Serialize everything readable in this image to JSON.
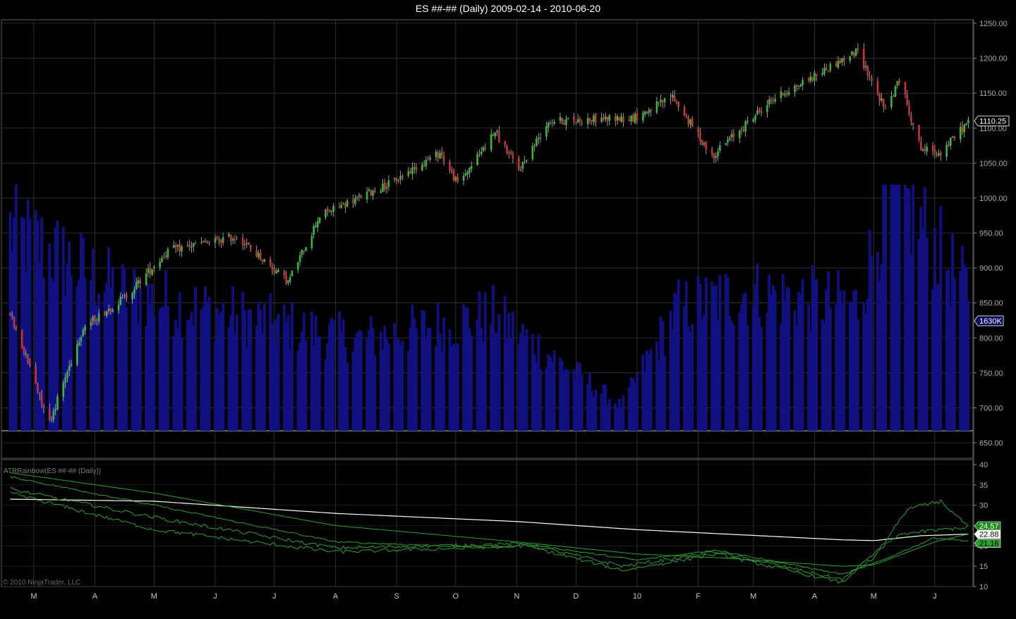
{
  "chart_title": "ES ##-## (Daily)  2009-02-14 - 2010-06-20",
  "price_axis": {
    "ticks": [
      "1250.00",
      "1200.00",
      "1150.00",
      "1100.00",
      "1050.00",
      "1000.00",
      "950.00",
      "900.00",
      "850.00",
      "800.00",
      "750.00",
      "700.00",
      "650.00"
    ]
  },
  "last_price_tag": "1110.25",
  "volume_tag": "1630K",
  "indicator_label": "ATRRainbow(ES ##-## (Daily))",
  "indicator_axis": {
    "ticks": [
      "40",
      "35",
      "30",
      "25",
      "20",
      "15",
      "10"
    ]
  },
  "indicator_tags": [
    "24.57",
    "22.88",
    "21.16"
  ],
  "x_axis": {
    "months": [
      "M",
      "A",
      "M",
      "J",
      "J",
      "A",
      "S",
      "O",
      "N",
      "D",
      "10",
      "F",
      "M",
      "A",
      "M",
      "J"
    ]
  },
  "copyright": "© 2010 NinjaTrader, LLC",
  "colors": {
    "up_candle": "#3cb43c",
    "down_candle": "#c83232",
    "volume": "#101080",
    "atr_line": "#2e9e2e",
    "atr_slow": "#ffffff",
    "grid": "#4a4a4a"
  },
  "chart_data": [
    {
      "type": "candlestick",
      "title": "ES ##-## (Daily)  2009-02-14 - 2010-06-20",
      "x_range": [
        "2009-02-14",
        "2010-06-20"
      ],
      "ylim": [
        650,
        1250
      ],
      "grid": true,
      "last_price": 1110.25,
      "close_waypoints": [
        [
          "2009-02-17",
          835
        ],
        [
          "2009-03-09",
          680
        ],
        [
          "2009-03-26",
          815
        ],
        [
          "2009-04-17",
          860
        ],
        [
          "2009-05-08",
          925
        ],
        [
          "2009-06-12",
          945
        ],
        [
          "2009-07-08",
          880
        ],
        [
          "2009-07-24",
          975
        ],
        [
          "2009-08-28",
          1020
        ],
        [
          "2009-09-23",
          1065
        ],
        [
          "2009-10-02",
          1020
        ],
        [
          "2009-10-21",
          1095
        ],
        [
          "2009-11-02",
          1040
        ],
        [
          "2009-11-17",
          1110
        ],
        [
          "2009-12-31",
          1115
        ],
        [
          "2010-01-19",
          1145
        ],
        [
          "2010-02-08",
          1060
        ],
        [
          "2010-03-10",
          1140
        ],
        [
          "2010-04-23",
          1210
        ],
        [
          "2010-05-07",
          1125
        ],
        [
          "2010-05-14",
          1170
        ],
        [
          "2010-05-25",
          1070
        ],
        [
          "2010-06-04",
          1065
        ],
        [
          "2010-06-18",
          1110
        ]
      ]
    },
    {
      "type": "bar",
      "series": [
        {
          "name": "volume",
          "unit": "K contracts"
        }
      ],
      "last_value": "1630K",
      "level_waypoints": [
        [
          "2009-02-17",
          0.8
        ],
        [
          "2009-04-15",
          0.55
        ],
        [
          "2009-06-10",
          0.46
        ],
        [
          "2009-08-12",
          0.36
        ],
        [
          "2009-10-20",
          0.46
        ],
        [
          "2009-12-24",
          0.1
        ],
        [
          "2010-01-21",
          0.48
        ],
        [
          "2010-02-25",
          0.55
        ],
        [
          "2010-04-23",
          0.5
        ],
        [
          "2010-05-10",
          0.98
        ],
        [
          "2010-06-18",
          0.55
        ]
      ]
    },
    {
      "type": "line",
      "title": "ATRRainbow(ES ##-## (Daily))",
      "ylim": [
        10,
        40
      ],
      "last_values": [
        24.57,
        22.88,
        21.16
      ],
      "series": [
        {
          "points": [
            [
              "2009-02-17",
              31.5
            ],
            [
              "2009-05-01",
              31
            ],
            [
              "2009-08-01",
              28
            ],
            [
              "2009-11-01",
              26
            ],
            [
              "2010-01-01",
              24
            ],
            [
              "2010-04-15",
              21.5
            ],
            [
              "2010-05-01",
              21.3
            ],
            [
              "2010-05-25",
              22.5
            ],
            [
              "2010-06-18",
              22.9
            ]
          ]
        },
        {
          "points": [
            [
              "2009-02-17",
              38
            ],
            [
              "2009-05-01",
              33
            ],
            [
              "2009-08-01",
              25
            ],
            [
              "2009-11-01",
              21
            ],
            [
              "2010-01-01",
              18
            ],
            [
              "2010-02-15",
              17
            ],
            [
              "2010-04-15",
              15
            ],
            [
              "2010-05-01",
              15.3
            ],
            [
              "2010-06-01",
              21
            ],
            [
              "2010-06-18",
              22.9
            ]
          ]
        },
        {
          "points": [
            [
              "2009-02-17",
              37
            ],
            [
              "2009-05-01",
              30
            ],
            [
              "2009-08-01",
              21
            ],
            [
              "2009-10-25",
              19.5
            ],
            [
              "2009-11-05",
              20.5
            ],
            [
              "2010-01-01",
              16.5
            ],
            [
              "2010-02-10",
              19
            ],
            [
              "2010-04-15",
              13
            ],
            [
              "2010-05-03",
              16
            ],
            [
              "2010-06-01",
              22
            ],
            [
              "2010-06-18",
              21.2
            ]
          ]
        },
        {
          "points": [
            [
              "2009-02-17",
              34
            ],
            [
              "2009-05-01",
              27
            ],
            [
              "2009-08-01",
              19.5
            ],
            [
              "2009-11-05",
              20.5
            ],
            [
              "2009-12-25",
              15
            ],
            [
              "2010-02-10",
              18.5
            ],
            [
              "2010-04-15",
              11.8
            ],
            [
              "2010-05-01",
              17
            ],
            [
              "2010-05-18",
              29
            ],
            [
              "2010-06-04",
              31
            ],
            [
              "2010-06-18",
              24.6
            ]
          ]
        },
        {
          "points": [
            [
              "2009-02-17",
              33
            ],
            [
              "2009-05-01",
              24
            ],
            [
              "2009-08-01",
              18.5
            ],
            [
              "2009-11-05",
              20
            ],
            [
              "2009-12-25",
              14
            ],
            [
              "2010-02-10",
              18
            ],
            [
              "2010-04-15",
              11
            ],
            [
              "2010-05-01",
              18
            ],
            [
              "2010-05-15",
              23
            ],
            [
              "2010-06-18",
              24.6
            ]
          ]
        }
      ]
    }
  ]
}
